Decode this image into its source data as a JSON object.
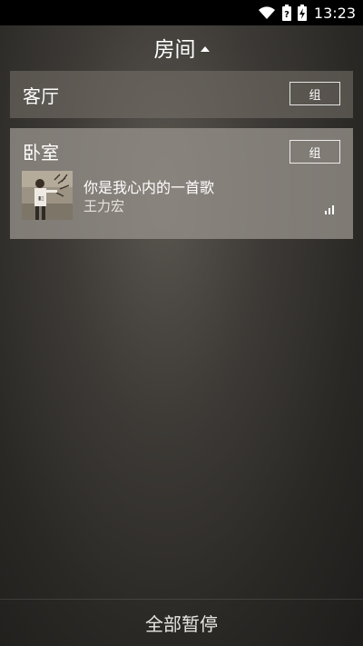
{
  "status_bar": {
    "time": "13:23",
    "icons": [
      "wifi-icon",
      "battery-unknown-icon",
      "battery-charging-icon"
    ]
  },
  "header": {
    "title": "房间",
    "caret_icon": "caret-up-icon"
  },
  "rooms": [
    {
      "name": "客厅",
      "group_label": "组"
    },
    {
      "name": "卧室",
      "group_label": "组",
      "now_playing": {
        "song": "你是我心内的一首歌",
        "artist": "王力宏",
        "album_art": "album-art-image",
        "indicator_icon": "volume-bars-icon"
      }
    }
  ],
  "footer": {
    "pause_all_label": "全部暂停"
  }
}
